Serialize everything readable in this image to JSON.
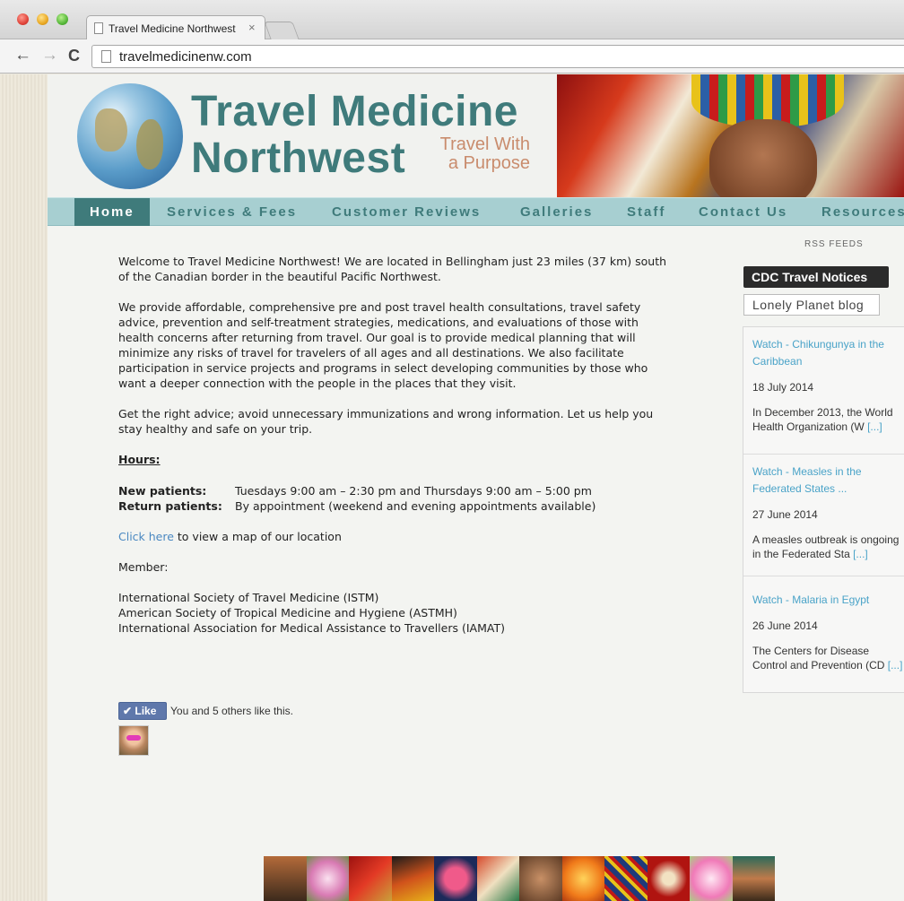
{
  "browser": {
    "tab_title": "Travel Medicine Northwest",
    "tab_close": "×",
    "url": "travelmedicinenw.com",
    "back_icon": "←",
    "forward_icon": "→",
    "reload_icon": "C"
  },
  "header": {
    "brand_line1": "Travel Medicine",
    "brand_line2": "Northwest",
    "tagline_line1": "Travel With",
    "tagline_line2": "a Purpose"
  },
  "nav": {
    "items": [
      "Home",
      "Services & Fees",
      "Customer Reviews",
      "Galleries",
      "Staff",
      "Contact Us",
      "Resources"
    ]
  },
  "content": {
    "p1": "Welcome to Travel Medicine Northwest!  We are located in Bellingham just 23 miles (37 km) south of the Canadian border in the beautiful Pacific Northwest.",
    "p2": "We provide affordable, comprehensive pre and post travel health consultations, travel safety advice, prevention and self-treatment strategies, medications, and evaluations of those with health concerns after returning from travel.  Our goal is to provide medical planning that will minimize any risks of travel for travelers of all ages and all destinations. We also facilitate participation in service projects and programs in select developing communities by those who want a deeper connection with the people in the places that they visit.",
    "p3": "Get the right advice; avoid unnecessary immunizations and wrong information.  Let us help you stay healthy and safe on your trip.",
    "hours_title": "Hours:",
    "new_patients_label": "New patients:",
    "new_patients_value": "Tuesdays 9:00 am – 2:30 pm and Thursdays 9:00 am – 5:00 pm",
    "return_patients_label": "Return patients:",
    "return_patients_value": "By appointment (weekend and evening appointments available)",
    "map_link": "Click here",
    "map_text": " to view a map of our location",
    "member_label": "Member:",
    "members": [
      "International Society of Travel Medicine (ISTM)",
      "American Society of Tropical Medicine and Hygiene (ASTMH)",
      "International Association for Medical Assistance to Travellers (IAMAT)"
    ]
  },
  "like": {
    "button": "✔ Like",
    "text": "You and 5 others like this."
  },
  "sidebar": {
    "rss_title": "RSS FEEDS",
    "feed_tab_active": "CDC Travel Notices",
    "feed_tab_inactive": "Lonely Planet blog",
    "more_link": "[...]",
    "items": [
      {
        "title": "Watch - Chikungunya in the Caribbean",
        "date": "18 July 2014",
        "excerpt": "In December 2013, the World Health Organization (W"
      },
      {
        "title": "Watch - Measles in the Federated States ...",
        "date": "27 June 2014",
        "excerpt": "A measles outbreak is ongoing in the Federated Sta"
      },
      {
        "title": "Watch - Malaria in Egypt",
        "date": "26 June 2014",
        "excerpt": "The Centers for Disease Control and Prevention (CD"
      }
    ]
  },
  "colors": {
    "brand_teal": "#3f7b7b",
    "nav_bg": "#a7cfd1",
    "tagline": "#c98c6d",
    "link": "#4a88c1"
  }
}
